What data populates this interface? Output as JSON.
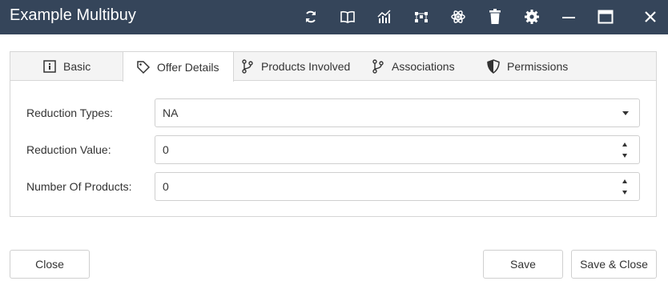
{
  "window": {
    "title": "Example Multibuy",
    "toolbar_icons": [
      "refresh-icon",
      "book-icon",
      "chart-icon",
      "nodes-icon",
      "atom-icon",
      "trash-icon",
      "gear-icon",
      "minimize-icon",
      "maximize-icon",
      "close-icon"
    ]
  },
  "tabs": [
    {
      "label": "Basic",
      "icon": "info-icon"
    },
    {
      "label": "Offer Details",
      "icon": "tag-icon",
      "active": true
    },
    {
      "label": "Products Involved",
      "icon": "branch-icon"
    },
    {
      "label": "Associations",
      "icon": "branch-icon"
    },
    {
      "label": "Permissions",
      "icon": "shield-icon"
    }
  ],
  "form": {
    "reduction_types": {
      "label": "Reduction Types:",
      "value": "NA"
    },
    "reduction_value": {
      "label": "Reduction Value:",
      "value": "0"
    },
    "number_of_products": {
      "label": "Number Of Products:",
      "value": "0"
    }
  },
  "buttons": {
    "close": "Close",
    "save": "Save",
    "save_close": "Save & Close"
  },
  "colors": {
    "titlebar_bg": "#35455a",
    "panel_border": "#d6d6d6",
    "tab_strip_bg": "#f4f4f4"
  }
}
